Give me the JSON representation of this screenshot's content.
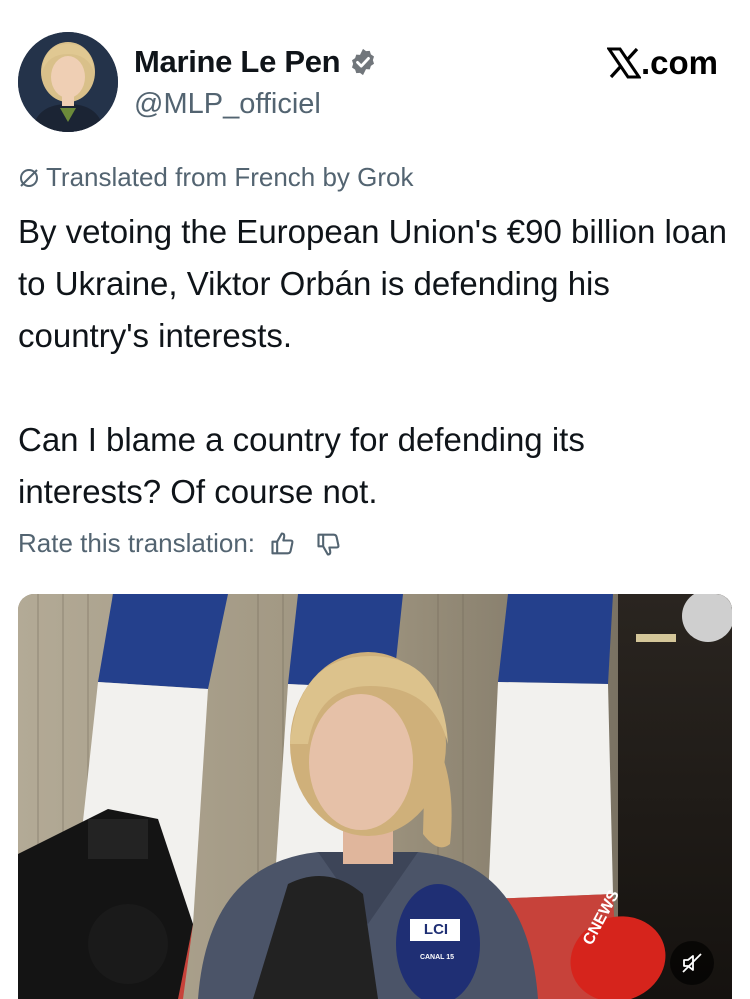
{
  "author": {
    "name": "Marine Le Pen",
    "handle": "@MLP_officiel",
    "verified": true,
    "badge_color": "#71767b"
  },
  "site": {
    "logo_icon": "x-logo-icon",
    "domain": ".com"
  },
  "translation": {
    "label": "Translated from French by Grok",
    "icon": "grok-icon"
  },
  "tweet": {
    "paragraph_1": "By vetoing the European Union's €90 billion loan to Ukraine, Viktor Orbán is defending his country's interests.",
    "paragraph_2": "Can I blame a country for defending its interests? Of course not."
  },
  "rate": {
    "label": "Rate this translation:",
    "thumbs_up_icon": "thumbs-up-icon",
    "thumbs_down_icon": "thumbs-down-icon"
  },
  "media": {
    "type": "video",
    "microphone_labels": {
      "lci": "LCI",
      "lci_sub": "CANAL 15",
      "cnews": "CNEWS"
    },
    "mute_icon": "muted-speaker-icon"
  },
  "colors": {
    "text_primary": "#0f1419",
    "text_secondary": "#536471",
    "flag_blue": "#1f3f8c",
    "flag_white": "#f4f4f2"
  }
}
